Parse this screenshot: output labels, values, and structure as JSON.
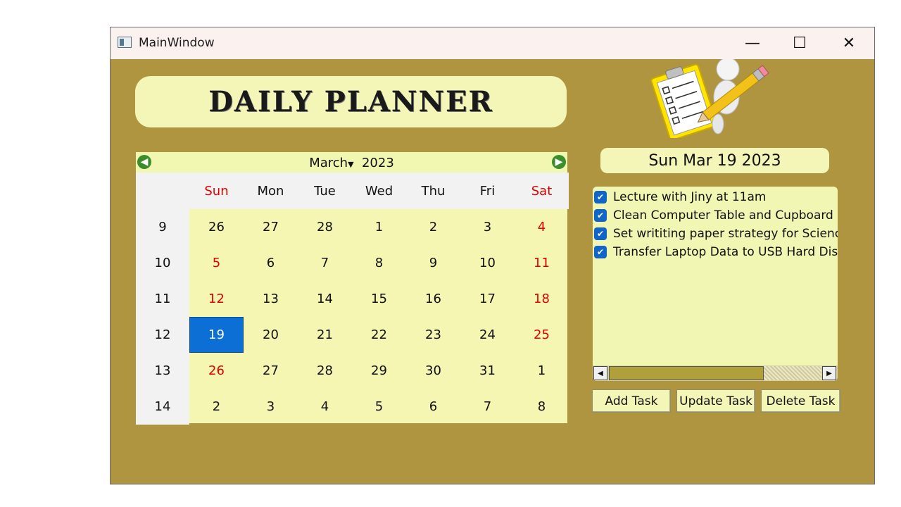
{
  "window": {
    "title": "MainWindow",
    "minimize_glyph": "—",
    "maximize_glyph": "☐",
    "close_glyph": "✕"
  },
  "header": {
    "title": "DAILY PLANNER"
  },
  "calendar": {
    "month": "March",
    "year": "2023",
    "weekday_headers": [
      "Sun",
      "Mon",
      "Tue",
      "Wed",
      "Thu",
      "Fri",
      "Sat"
    ],
    "weeks": [
      {
        "week": "9",
        "days": [
          "26",
          "27",
          "28",
          "1",
          "2",
          "3",
          "4"
        ]
      },
      {
        "week": "10",
        "days": [
          "5",
          "6",
          "7",
          "8",
          "9",
          "10",
          "11"
        ]
      },
      {
        "week": "11",
        "days": [
          "12",
          "13",
          "14",
          "15",
          "16",
          "17",
          "18"
        ]
      },
      {
        "week": "12",
        "days": [
          "19",
          "20",
          "21",
          "22",
          "23",
          "24",
          "25"
        ]
      },
      {
        "week": "13",
        "days": [
          "26",
          "27",
          "28",
          "29",
          "30",
          "31",
          "1"
        ]
      },
      {
        "week": "14",
        "days": [
          "2",
          "3",
          "4",
          "5",
          "6",
          "7",
          "8"
        ]
      }
    ],
    "selected_date": "19",
    "weekend_color": "#e00000",
    "selected_color": "#0c6fd6"
  },
  "selected_date_label": "Sun Mar 19 2023",
  "tasks": [
    {
      "text": "Lecture with Jiny at 11am",
      "checked": true
    },
    {
      "text": "Clean Computer Table and Cupboard",
      "checked": true
    },
    {
      "text": "Set writiting paper strategy for Science s",
      "checked": true
    },
    {
      "text": "Transfer Laptop Data to USB Hard Disk",
      "checked": true
    }
  ],
  "buttons": {
    "add": "Add Task",
    "update": "Update Task",
    "delete": "Delete Task"
  },
  "colors": {
    "window_bg": "#b09540",
    "panel_bg": "#f3f6b6",
    "checkbox": "#1065c8"
  }
}
